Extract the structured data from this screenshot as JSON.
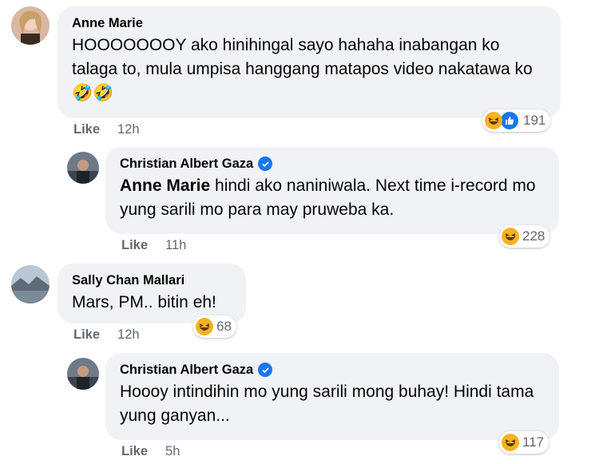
{
  "comments": [
    {
      "author": "Anne Marie",
      "text": "HOOOOOOOY ako hinihingal sayo hahaha inabangan ko talaga to, mula umpisa hanggang matapos video nakatawa ko",
      "emoji_text": "🤣🤣",
      "like_label": "Like",
      "time": "12h",
      "reaction_count": "191",
      "reactions": [
        "haha-icon",
        "like-icon"
      ],
      "replies": [
        {
          "author": "Christian Albert Gaza",
          "verified": true,
          "mention": "Anne Marie",
          "text": " hindi ako naniniwala. Next time i-record mo yung sarili mo para may pruweba ka.",
          "like_label": "Like",
          "time": "11h",
          "reaction_count": "228",
          "reactions": [
            "haha-icon"
          ]
        }
      ]
    },
    {
      "author": "Sally Chan Mallari",
      "text": "Mars, PM.. bitin eh!",
      "like_label": "Like",
      "time": "12h",
      "reaction_count": "68",
      "reactions": [
        "haha-icon"
      ],
      "replies": [
        {
          "author": "Christian Albert Gaza",
          "verified": true,
          "text": "Hoooy intindihin mo yung sarili mong buhay! Hindi tama yung ganyan...",
          "like_label": "Like",
          "time": "5h",
          "reaction_count": "117",
          "reactions": [
            "haha-icon"
          ]
        }
      ]
    }
  ],
  "colors": {
    "bubble": "#f0f2f5",
    "meta_text": "#65676b",
    "verified_blue": "#1877f2",
    "haha_yellow": "#f7b125"
  }
}
